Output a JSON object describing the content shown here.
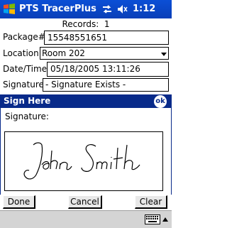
{
  "titlebar": {
    "app_title": "PTS TracerPlus",
    "time": "1:12",
    "icons": [
      "windows-start-icon",
      "connectivity-icon",
      "speaker-icon"
    ]
  },
  "form": {
    "records_text": "Records:  1",
    "package_label": "Package#:",
    "package_value": "15548551651",
    "location_label": "Location:",
    "location_value": "Room 202",
    "datetime_label": "Date/Time:",
    "datetime_value": "05/18/2005 13:11:26",
    "signature_label": "Signature:",
    "signature_value": "- Signature Exists -"
  },
  "sign_panel": {
    "title": "Sign Here",
    "ok_label": "ok",
    "signature_field_label": "Signature:",
    "signature_image_text": "John Smith"
  },
  "buttons": {
    "done": "Done",
    "cancel": "Cancel",
    "clear": "Clear"
  },
  "bottombar": {
    "input_icon": "keyboard-icon"
  },
  "colors": {
    "titlebar": "#0b4fd6",
    "sign_header": "#082a8a"
  }
}
